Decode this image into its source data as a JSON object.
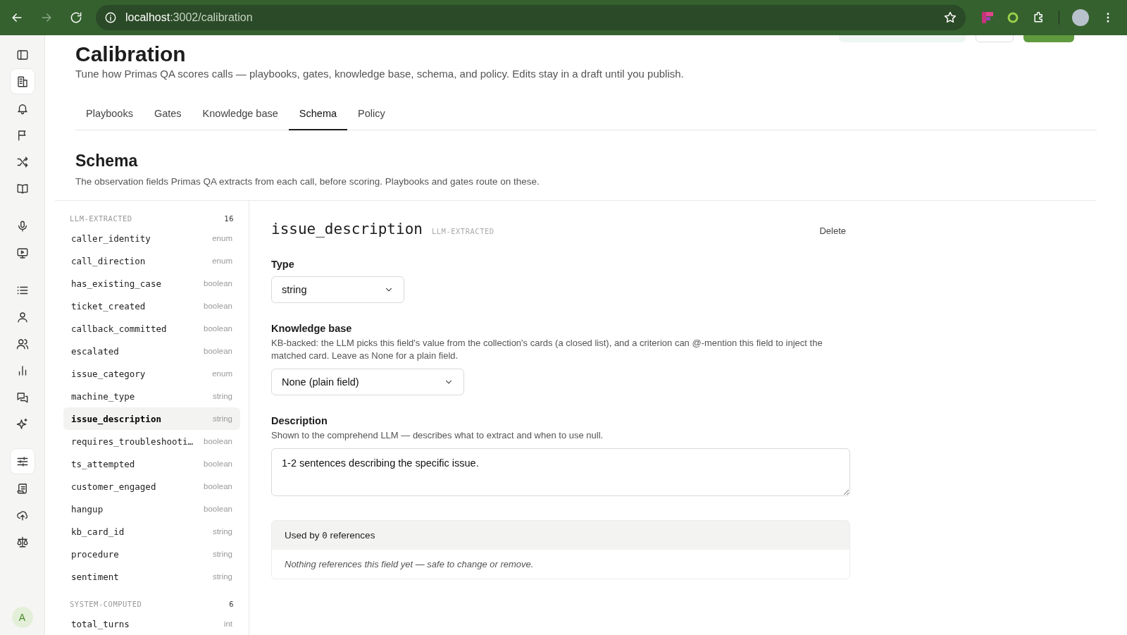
{
  "browser": {
    "url_host": "localhost",
    "url_rest": ":3002/calibration"
  },
  "rail": {
    "groups": [
      {
        "items": [
          {
            "selected": false
          },
          {
            "selected": true
          },
          {
            "selected": false
          },
          {
            "selected": false
          },
          {
            "selected": false
          },
          {
            "selected": false
          }
        ]
      },
      {
        "items": [
          {
            "selected": false
          },
          {
            "selected": false
          }
        ]
      },
      {
        "items": [
          {
            "selected": false
          },
          {
            "selected": false
          },
          {
            "selected": false
          },
          {
            "selected": false
          },
          {
            "selected": false
          },
          {
            "selected": false
          }
        ]
      },
      {
        "items": [
          {
            "selected": true
          },
          {
            "selected": false
          },
          {
            "selected": false
          },
          {
            "selected": false
          }
        ]
      }
    ],
    "avatar": "A"
  },
  "page": {
    "title": "Calibration",
    "subtitle": "Tune how Primas QA scores calls — playbooks, gates, knowledge base, schema, and policy. Edits stay in a draft until you publish."
  },
  "tabs": [
    {
      "label": "Playbooks",
      "selected": false
    },
    {
      "label": "Gates",
      "selected": false
    },
    {
      "label": "Knowledge base",
      "selected": false
    },
    {
      "label": "Schema",
      "selected": true
    },
    {
      "label": "Policy",
      "selected": false
    }
  ],
  "section": {
    "title": "Schema",
    "description": "The observation fields Primas QA extracts from each call, before scoring. Playbooks and gates route on these."
  },
  "field_groups": [
    {
      "label": "LLM-EXTRACTED",
      "count": "16",
      "fields": [
        {
          "name": "caller_identity",
          "type": "enum",
          "selected": false
        },
        {
          "name": "call_direction",
          "type": "enum",
          "selected": false
        },
        {
          "name": "has_existing_case",
          "type": "boolean",
          "selected": false
        },
        {
          "name": "ticket_created",
          "type": "boolean",
          "selected": false
        },
        {
          "name": "callback_committed",
          "type": "boolean",
          "selected": false
        },
        {
          "name": "escalated",
          "type": "boolean",
          "selected": false
        },
        {
          "name": "issue_category",
          "type": "enum",
          "selected": false
        },
        {
          "name": "machine_type",
          "type": "string",
          "selected": false
        },
        {
          "name": "issue_description",
          "type": "string",
          "selected": true
        },
        {
          "name": "requires_troubleshooti…",
          "type": "boolean",
          "selected": false
        },
        {
          "name": "ts_attempted",
          "type": "boolean",
          "selected": false
        },
        {
          "name": "customer_engaged",
          "type": "boolean",
          "selected": false
        },
        {
          "name": "hangup",
          "type": "boolean",
          "selected": false
        },
        {
          "name": "kb_card_id",
          "type": "string",
          "selected": false
        },
        {
          "name": "procedure",
          "type": "string",
          "selected": false
        },
        {
          "name": "sentiment",
          "type": "string",
          "selected": false
        }
      ]
    },
    {
      "label": "SYSTEM-COMPUTED",
      "count": "6",
      "fields": [
        {
          "name": "total_turns",
          "type": "int",
          "selected": false
        }
      ]
    }
  ],
  "detail": {
    "name": "issue_description",
    "badge": "LLM-EXTRACTED",
    "delete": "Delete",
    "type_label": "Type",
    "type_value": "string",
    "kb_label": "Knowledge base",
    "kb_help": "KB-backed: the LLM picks this field's value from the collection's cards (a closed list), and a criterion can @-mention this field to inject the matched card. Leave as None for a plain field.",
    "kb_value": "None (plain field)",
    "desc_label": "Description",
    "desc_help": "Shown to the comprehend LLM — describes what to extract and when to use null.",
    "desc_value": "1-2 sentences describing the specific issue.",
    "refs_prefix": "Used by",
    "refs_count": "0",
    "refs_suffix": "references",
    "refs_empty": "Nothing references this field yet — safe to change or remove."
  }
}
